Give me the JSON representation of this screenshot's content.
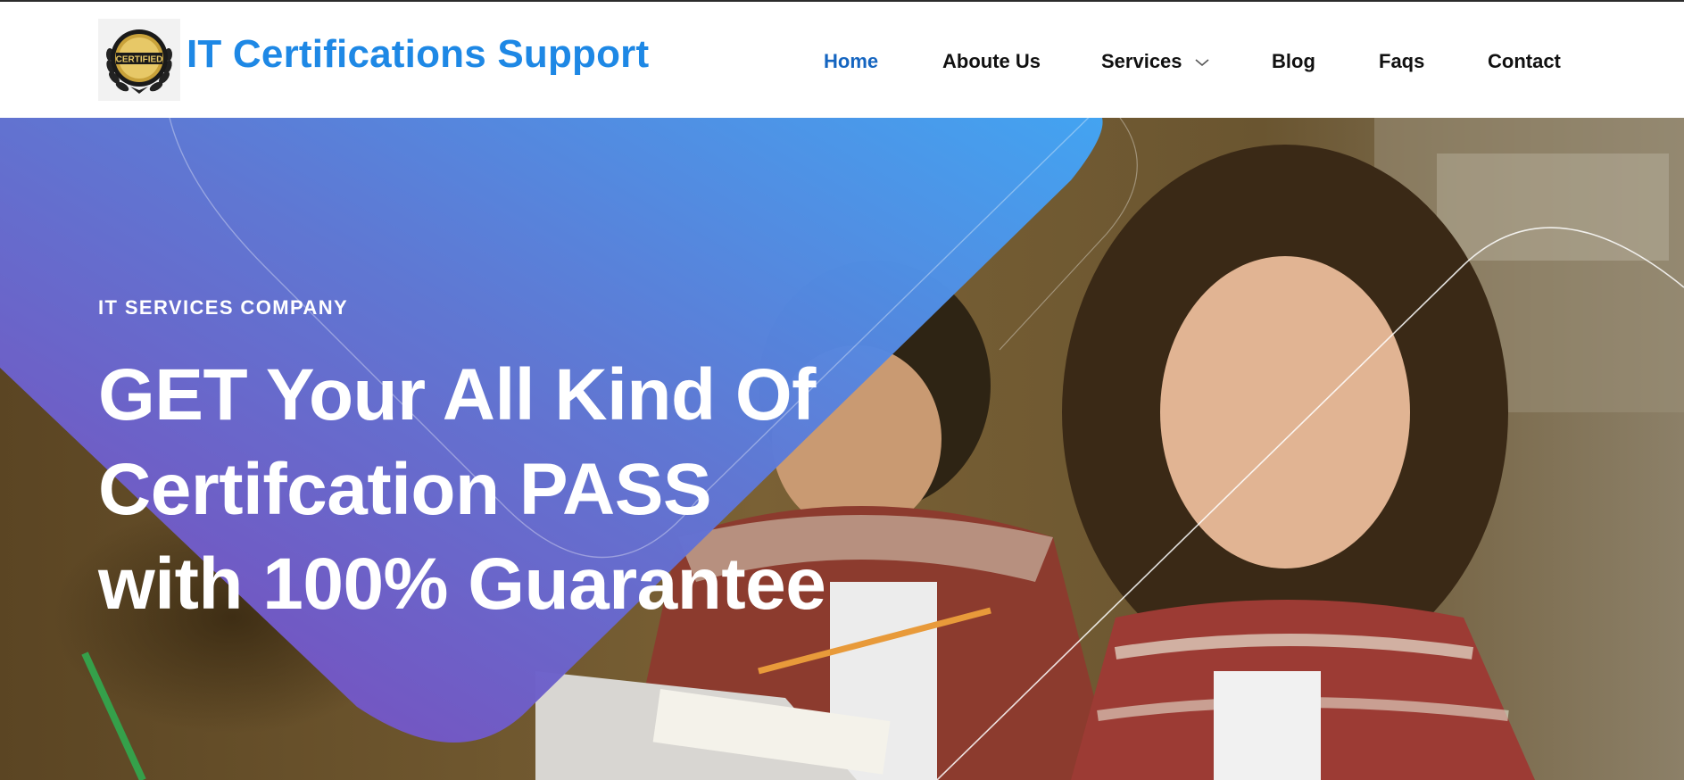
{
  "brand": {
    "name": "IT Certifications Support",
    "logo_text": "CERTIFIED"
  },
  "nav": {
    "items": [
      {
        "label": "Home",
        "active": true
      },
      {
        "label": "Aboute Us",
        "active": false
      },
      {
        "label": "Services",
        "active": false,
        "has_dropdown": true
      },
      {
        "label": "Blog",
        "active": false
      },
      {
        "label": "Faqs",
        "active": false
      },
      {
        "label": "Contact",
        "active": false
      }
    ]
  },
  "hero": {
    "eyebrow": "IT SERVICES COMPANY",
    "headline": "GET Your All Kind Of Certifcation PASS with 100% Guarantee",
    "image": "two-students-studying-photo"
  },
  "colors": {
    "brand_blue": "#1e88e5",
    "nav_active": "#1565c0",
    "gradient_start": "#7e46bd",
    "gradient_end": "#42a5f5"
  }
}
